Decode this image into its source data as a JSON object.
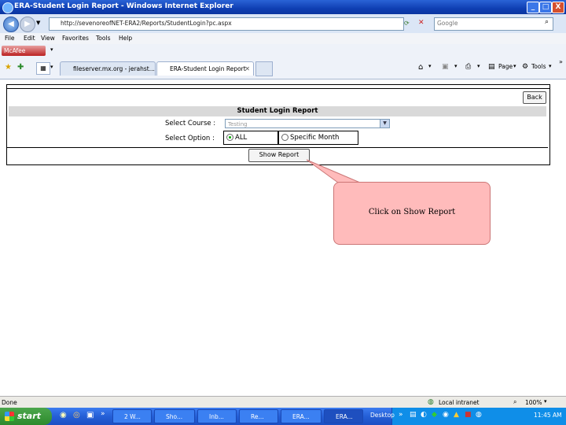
{
  "window": {
    "title": "ERA-Student Login Report - Windows Internet Explorer",
    "controls": [
      "_",
      "□",
      "X"
    ]
  },
  "address_bar": {
    "url": "http://sevenoreofNET-ERA2/Reports/StudentLogin?pc.aspx",
    "search_placeholder": "Google"
  },
  "menu": [
    "File",
    "Edit",
    "View",
    "Favorites",
    "Tools",
    "Help"
  ],
  "links_bar": {
    "mcafee": "McAfee"
  },
  "tabs": [
    {
      "label": "fileserver.mx.org - jerahst...",
      "active": false
    },
    {
      "label": "ERA-Student Login Report",
      "active": true
    }
  ],
  "toolbar": {
    "page": "Page",
    "tools": "Tools"
  },
  "report": {
    "back_label": "Back",
    "header": "Student Login Report",
    "select_course_label": "Select Course :",
    "course_value": "Testing",
    "select_option_label": "Select Option :",
    "option_all": "ALL",
    "option_specific": "Specific Month",
    "selected_option": "ALL",
    "show_report_label": "Show Report"
  },
  "callout": {
    "text": "Click on Show Report"
  },
  "status_bar": {
    "left": "Done",
    "zone": "Local intranet",
    "zoom": "100%"
  },
  "taskbar": {
    "start_label": "start",
    "tasks": [
      "2 W...",
      "Sho...",
      "Inb...",
      "Re...",
      "ERA...",
      "ERA..."
    ],
    "tray_label": "Desktop",
    "clock": "11:45 AM"
  },
  "colors": {
    "callout_fill": "#ffbbbb",
    "report_header_bg": "#d9d9d9",
    "titlebar": "#0f3fb3"
  }
}
